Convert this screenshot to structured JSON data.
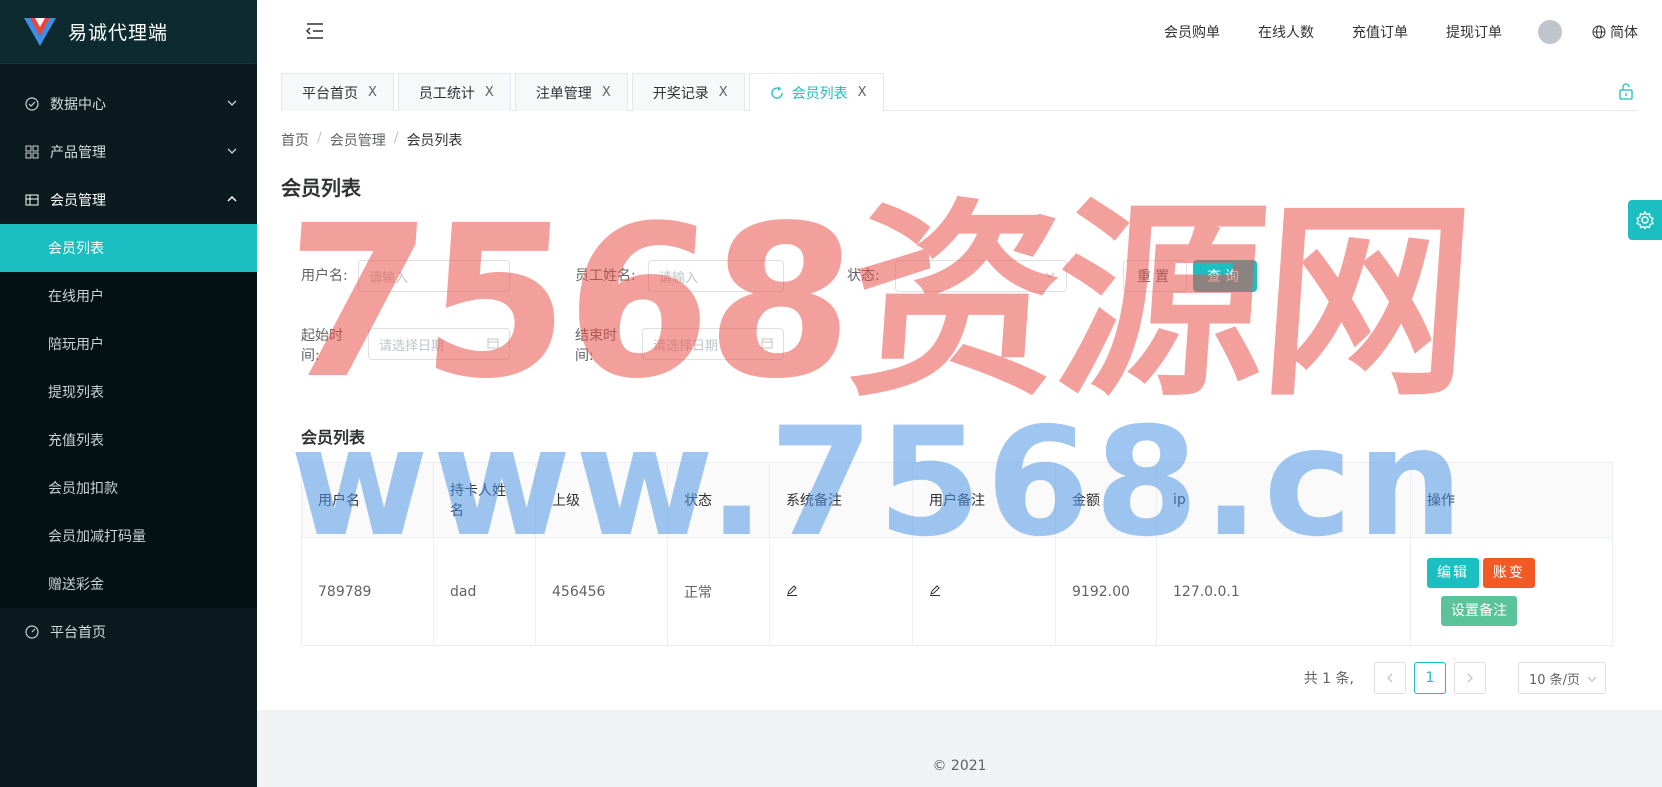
{
  "app": {
    "name": "易诚代理端"
  },
  "sidebar": {
    "items": [
      {
        "label": "数据中心"
      },
      {
        "label": "产品管理"
      },
      {
        "label": "会员管理"
      },
      {
        "label": "平台首页"
      }
    ],
    "submenu": [
      {
        "label": "会员列表"
      },
      {
        "label": "在线用户"
      },
      {
        "label": "陪玩用户"
      },
      {
        "label": "提现列表"
      },
      {
        "label": "充值列表"
      },
      {
        "label": "会员加扣款"
      },
      {
        "label": "会员加减打码量"
      },
      {
        "label": "赠送彩金"
      }
    ]
  },
  "header": {
    "links": [
      "会员购单",
      "在线人数",
      "充值订单",
      "提现订单"
    ],
    "lang": "简体"
  },
  "tabs": [
    {
      "label": "平台首页",
      "close": "X"
    },
    {
      "label": "员工统计",
      "close": "X"
    },
    {
      "label": "注单管理",
      "close": "X"
    },
    {
      "label": "开奖记录",
      "close": "X"
    },
    {
      "label": "会员列表",
      "close": "X"
    }
  ],
  "breadcrumb": [
    "首页",
    "会员管理",
    "会员列表"
  ],
  "breadcrumb_sep": "/",
  "page_title": "会员列表",
  "filters": {
    "username_label": "用户名:",
    "username_placeholder": "请输入",
    "staff_label": "员工姓名:",
    "staff_placeholder": "请输入",
    "status_label": "状态:",
    "start_label": "起始时间:",
    "start_placeholder": "请选择日期",
    "end_label": "结束时间:",
    "end_placeholder": "请选择日期",
    "reset": "重置",
    "query": "查询"
  },
  "table": {
    "title": "会员列表",
    "headers": [
      "用户名",
      "持卡人姓名",
      "上级",
      "状态",
      "系统备注",
      "用户备注",
      "金额",
      "ip",
      "操作"
    ],
    "rows": [
      {
        "username": "789789",
        "cardholder": "dad",
        "parent": "456456",
        "status": "正常",
        "amount": "9192.00",
        "ip": "127.0.0.1"
      }
    ],
    "actions": {
      "edit": "编辑",
      "account": "账变",
      "remark": "设置备注"
    }
  },
  "pagination": {
    "total": "共 1 条,",
    "current": "1",
    "page_size": "10 条/页"
  },
  "footer": {
    "text": "2021"
  },
  "watermark": {
    "line1": "7568资源网",
    "line2": "www.7568.cn"
  },
  "colors": {
    "accent": "#1bbfc1",
    "sidebar_bg": "#0b1a1f",
    "danger": "#f15a24",
    "success": "#5bc39a"
  }
}
